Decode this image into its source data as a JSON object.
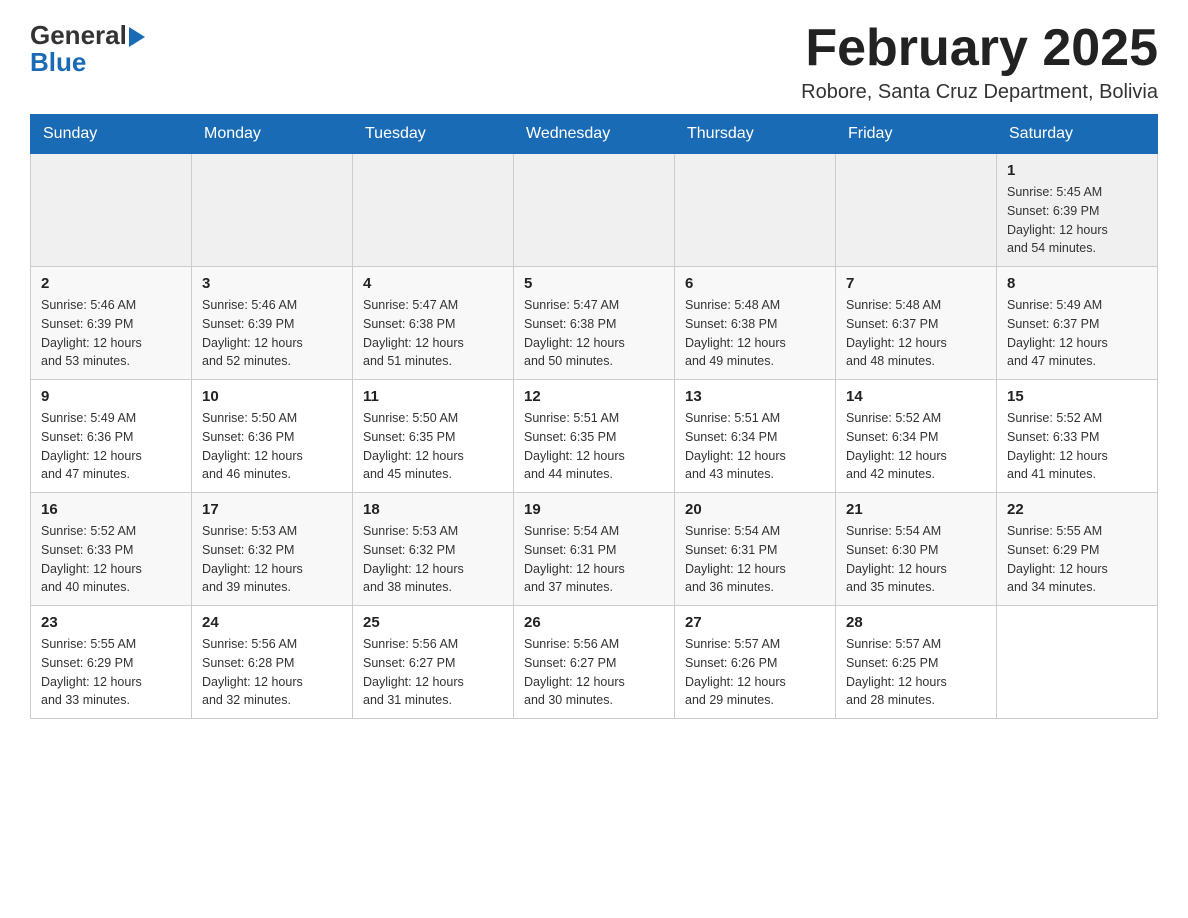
{
  "header": {
    "logo_general": "General",
    "logo_blue": "Blue",
    "title": "February 2025",
    "subtitle": "Robore, Santa Cruz Department, Bolivia"
  },
  "weekdays": [
    "Sunday",
    "Monday",
    "Tuesday",
    "Wednesday",
    "Thursday",
    "Friday",
    "Saturday"
  ],
  "rows": [
    {
      "cells": [
        {
          "day": "",
          "info": ""
        },
        {
          "day": "",
          "info": ""
        },
        {
          "day": "",
          "info": ""
        },
        {
          "day": "",
          "info": ""
        },
        {
          "day": "",
          "info": ""
        },
        {
          "day": "",
          "info": ""
        },
        {
          "day": "1",
          "info": "Sunrise: 5:45 AM\nSunset: 6:39 PM\nDaylight: 12 hours\nand 54 minutes."
        }
      ]
    },
    {
      "cells": [
        {
          "day": "2",
          "info": "Sunrise: 5:46 AM\nSunset: 6:39 PM\nDaylight: 12 hours\nand 53 minutes."
        },
        {
          "day": "3",
          "info": "Sunrise: 5:46 AM\nSunset: 6:39 PM\nDaylight: 12 hours\nand 52 minutes."
        },
        {
          "day": "4",
          "info": "Sunrise: 5:47 AM\nSunset: 6:38 PM\nDaylight: 12 hours\nand 51 minutes."
        },
        {
          "day": "5",
          "info": "Sunrise: 5:47 AM\nSunset: 6:38 PM\nDaylight: 12 hours\nand 50 minutes."
        },
        {
          "day": "6",
          "info": "Sunrise: 5:48 AM\nSunset: 6:38 PM\nDaylight: 12 hours\nand 49 minutes."
        },
        {
          "day": "7",
          "info": "Sunrise: 5:48 AM\nSunset: 6:37 PM\nDaylight: 12 hours\nand 48 minutes."
        },
        {
          "day": "8",
          "info": "Sunrise: 5:49 AM\nSunset: 6:37 PM\nDaylight: 12 hours\nand 47 minutes."
        }
      ]
    },
    {
      "cells": [
        {
          "day": "9",
          "info": "Sunrise: 5:49 AM\nSunset: 6:36 PM\nDaylight: 12 hours\nand 47 minutes."
        },
        {
          "day": "10",
          "info": "Sunrise: 5:50 AM\nSunset: 6:36 PM\nDaylight: 12 hours\nand 46 minutes."
        },
        {
          "day": "11",
          "info": "Sunrise: 5:50 AM\nSunset: 6:35 PM\nDaylight: 12 hours\nand 45 minutes."
        },
        {
          "day": "12",
          "info": "Sunrise: 5:51 AM\nSunset: 6:35 PM\nDaylight: 12 hours\nand 44 minutes."
        },
        {
          "day": "13",
          "info": "Sunrise: 5:51 AM\nSunset: 6:34 PM\nDaylight: 12 hours\nand 43 minutes."
        },
        {
          "day": "14",
          "info": "Sunrise: 5:52 AM\nSunset: 6:34 PM\nDaylight: 12 hours\nand 42 minutes."
        },
        {
          "day": "15",
          "info": "Sunrise: 5:52 AM\nSunset: 6:33 PM\nDaylight: 12 hours\nand 41 minutes."
        }
      ]
    },
    {
      "cells": [
        {
          "day": "16",
          "info": "Sunrise: 5:52 AM\nSunset: 6:33 PM\nDaylight: 12 hours\nand 40 minutes."
        },
        {
          "day": "17",
          "info": "Sunrise: 5:53 AM\nSunset: 6:32 PM\nDaylight: 12 hours\nand 39 minutes."
        },
        {
          "day": "18",
          "info": "Sunrise: 5:53 AM\nSunset: 6:32 PM\nDaylight: 12 hours\nand 38 minutes."
        },
        {
          "day": "19",
          "info": "Sunrise: 5:54 AM\nSunset: 6:31 PM\nDaylight: 12 hours\nand 37 minutes."
        },
        {
          "day": "20",
          "info": "Sunrise: 5:54 AM\nSunset: 6:31 PM\nDaylight: 12 hours\nand 36 minutes."
        },
        {
          "day": "21",
          "info": "Sunrise: 5:54 AM\nSunset: 6:30 PM\nDaylight: 12 hours\nand 35 minutes."
        },
        {
          "day": "22",
          "info": "Sunrise: 5:55 AM\nSunset: 6:29 PM\nDaylight: 12 hours\nand 34 minutes."
        }
      ]
    },
    {
      "cells": [
        {
          "day": "23",
          "info": "Sunrise: 5:55 AM\nSunset: 6:29 PM\nDaylight: 12 hours\nand 33 minutes."
        },
        {
          "day": "24",
          "info": "Sunrise: 5:56 AM\nSunset: 6:28 PM\nDaylight: 12 hours\nand 32 minutes."
        },
        {
          "day": "25",
          "info": "Sunrise: 5:56 AM\nSunset: 6:27 PM\nDaylight: 12 hours\nand 31 minutes."
        },
        {
          "day": "26",
          "info": "Sunrise: 5:56 AM\nSunset: 6:27 PM\nDaylight: 12 hours\nand 30 minutes."
        },
        {
          "day": "27",
          "info": "Sunrise: 5:57 AM\nSunset: 6:26 PM\nDaylight: 12 hours\nand 29 minutes."
        },
        {
          "day": "28",
          "info": "Sunrise: 5:57 AM\nSunset: 6:25 PM\nDaylight: 12 hours\nand 28 minutes."
        },
        {
          "day": "",
          "info": ""
        }
      ]
    }
  ]
}
